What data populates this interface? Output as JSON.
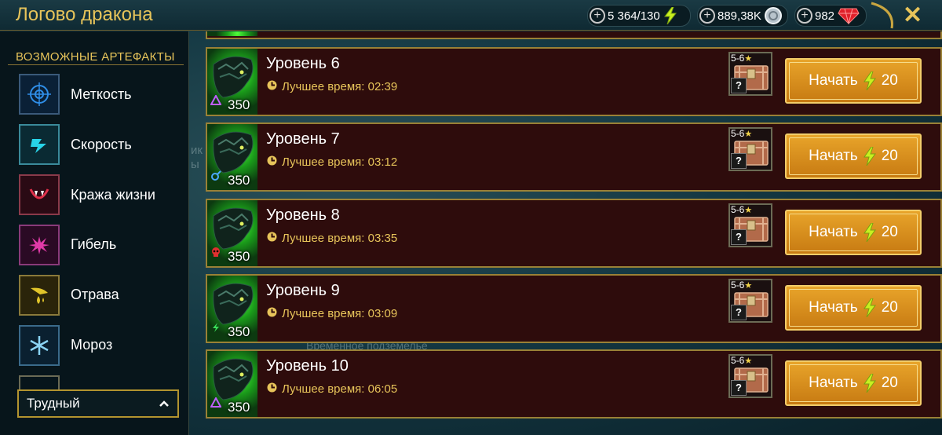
{
  "window": {
    "title": "Логово дракона"
  },
  "resources": {
    "energy": {
      "value": "5 364/130",
      "icon": "lightning-icon"
    },
    "silver": {
      "value": "889,38K",
      "icon": "silver-coin-icon"
    },
    "gems": {
      "value": "982",
      "icon": "ruby-icon"
    }
  },
  "sidebar": {
    "title": "ВОЗМОЖНЫЕ АРТЕФАКТЫ",
    "items": [
      {
        "label": "Меткость",
        "icon": "accuracy-target-icon",
        "color": "#2f8ee8"
      },
      {
        "label": "Скорость",
        "icon": "speed-boot-icon",
        "color": "#28d4e8"
      },
      {
        "label": "Кража жизни",
        "icon": "lifesteal-fangs-icon",
        "color": "#e0304a"
      },
      {
        "label": "Гибель",
        "icon": "destroy-burst-icon",
        "color": "#e03aa8"
      },
      {
        "label": "Отрава",
        "icon": "poison-drop-icon",
        "color": "#e0c42a"
      },
      {
        "label": "Мороз",
        "icon": "frost-snowflake-icon",
        "color": "#8ad4f4"
      }
    ],
    "difficulty": "Трудный"
  },
  "background_text": [
    "ик",
    "ы",
    "Временное подземелье"
  ],
  "levels": [
    {
      "name": "Уровень 6",
      "best": "Лучшее время: 02:39",
      "power": "350",
      "affinity_icon": "magic-triangle-icon",
      "affinity_color": "#c060ff",
      "chest_rank": "5-6",
      "start_label": "Начать",
      "energy_cost": "20"
    },
    {
      "name": "Уровень 7",
      "best": "Лучшее время: 03:12",
      "power": "350",
      "affinity_icon": "spirit-swirl-icon",
      "affinity_color": "#4aa8ff",
      "chest_rank": "5-6",
      "start_label": "Начать",
      "energy_cost": "20"
    },
    {
      "name": "Уровень 8",
      "best": "Лучшее время: 03:35",
      "power": "350",
      "affinity_icon": "force-skull-icon",
      "affinity_color": "#e03030",
      "chest_rank": "5-6",
      "start_label": "Начать",
      "energy_cost": "20"
    },
    {
      "name": "Уровень 9",
      "best": "Лучшее время: 03:09",
      "power": "350",
      "affinity_icon": "void-bolt-icon",
      "affinity_color": "#3ae05a",
      "chest_rank": "5-6",
      "start_label": "Начать",
      "energy_cost": "20"
    },
    {
      "name": "Уровень 10",
      "best": "Лучшее время: 06:05",
      "power": "350",
      "affinity_icon": "magic-triangle-icon",
      "affinity_color": "#c060ff",
      "chest_rank": "5-6",
      "start_label": "Начать",
      "energy_cost": "20"
    }
  ],
  "colors": {
    "accent_gold": "#e7c45a",
    "row_bg": "#2e0c0c",
    "button": "#d88c1c"
  }
}
